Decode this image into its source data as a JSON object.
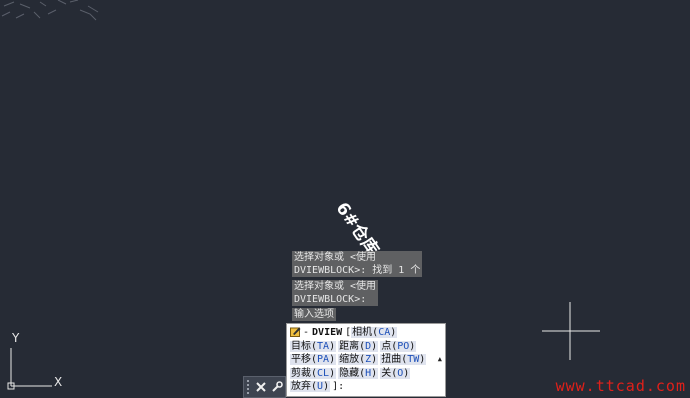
{
  "drawing": {
    "text_label": "6#仓库"
  },
  "command_history": [
    {
      "line1": "选择对象或 <使用",
      "line2": "DVIEWBLOCK>: 找到 1 个"
    },
    {
      "line1": "选择对象或 <使用",
      "line2": "DVIEWBLOCK>:"
    },
    {
      "line1": "输入选项"
    }
  ],
  "command_prompt": {
    "dash": "-",
    "command": "DVIEW",
    "bracket_open": "[",
    "options": [
      {
        "label": "相机",
        "key": "CA"
      },
      {
        "label": "目标",
        "key": "TA"
      },
      {
        "label": "距离",
        "key": "D"
      },
      {
        "label": "点",
        "key": "PO"
      },
      {
        "label": "平移",
        "key": "PA"
      },
      {
        "label": "缩放",
        "key": "Z"
      },
      {
        "label": "扭曲",
        "key": "TW"
      },
      {
        "label": "剪裁",
        "key": "CL"
      },
      {
        "label": "隐藏",
        "key": "H"
      },
      {
        "label": "关",
        "key": "O"
      },
      {
        "label": "放弃",
        "key": "U"
      }
    ],
    "bracket_close": "]:"
  },
  "toolbar": {
    "close_icon": "close-icon",
    "customize_icon": "wrench-icon"
  },
  "ucs": {
    "y_label": "Y",
    "x_label": "X"
  },
  "watermark": "www.ttcad.com",
  "colors": {
    "background": "#262b35",
    "option_key": "#1c4fb8",
    "watermark": "#e0201a"
  }
}
